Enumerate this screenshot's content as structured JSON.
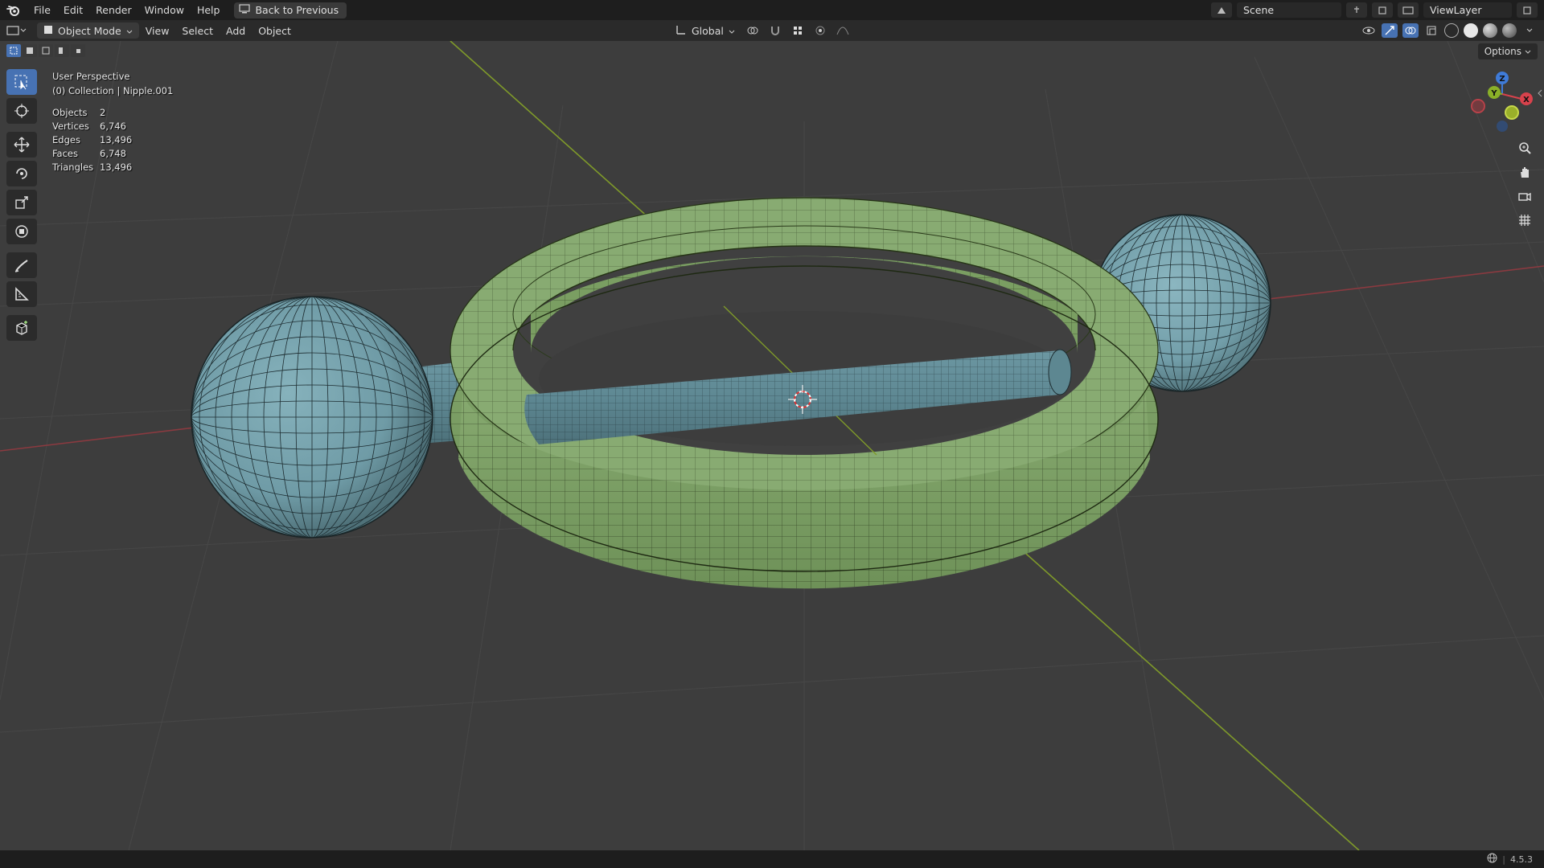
{
  "menu": {
    "items": [
      "File",
      "Edit",
      "Render",
      "Window",
      "Help"
    ],
    "back_button": "Back to Previous"
  },
  "topbar_right": {
    "scene": "Scene",
    "view_layer": "ViewLayer"
  },
  "viewport_header": {
    "mode": "Object Mode",
    "menus": [
      "View",
      "Select",
      "Add",
      "Object"
    ],
    "transform_orientation": "Global"
  },
  "viewport": {
    "options_label": "Options",
    "perspective": "User Perspective",
    "collection_line": "(0) Collection | Nipple.001",
    "stats": [
      {
        "label": "Objects",
        "value": "2"
      },
      {
        "label": "Vertices",
        "value": "6,746"
      },
      {
        "label": "Edges",
        "value": "13,496"
      },
      {
        "label": "Faces",
        "value": "6,748"
      },
      {
        "label": "Triangles",
        "value": "13,496"
      }
    ],
    "gizmo_axes": {
      "x": "X",
      "y": "Y",
      "z": "Z"
    }
  },
  "toolbar": {
    "tools": [
      "select-box",
      "cursor",
      "move",
      "rotate",
      "scale",
      "transform",
      "annotate",
      "measure",
      "add-cube"
    ],
    "active": "select-box"
  },
  "statusbar": {
    "version": "4.5.3"
  },
  "colors": {
    "accent": "#4772b3",
    "ring_mesh": "#7fa36a",
    "ball_mesh": "#6f9ba6",
    "axis_x": "#b8404a",
    "axis_y": "#7f9a2a",
    "background": "#3d3d3d"
  }
}
